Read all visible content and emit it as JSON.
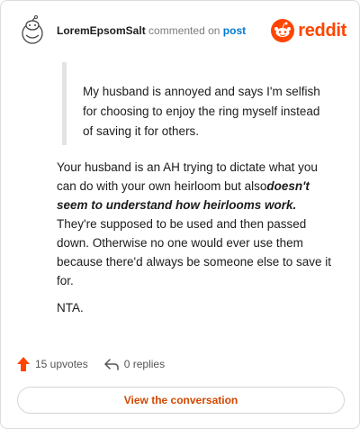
{
  "header": {
    "username": "LoremEpsomSalt",
    "commented_text": "commented on",
    "post_link": "post",
    "brand_word": "reddit",
    "avatar_icon": "snoo-avatar-icon",
    "brand_icon": "reddit-logo-icon"
  },
  "quote": {
    "text": "My husband is annoyed and says I'm selfish for choosing to enjoy the ring myself instead of saving it for others."
  },
  "comment": {
    "part1": "Your husband is an AH trying to dictate what you can do with your own heirloom but also",
    "emphasis": "doesn't seem to understand how heirlooms work.",
    "part2": " They're supposed to be used and then passed down. Otherwise no one would ever use them because there'd always be someone else to save it for.",
    "nta": "NTA."
  },
  "stats": {
    "upvotes": "15 upvotes",
    "replies": "0 replies",
    "upvote_icon": "upvote-arrow-icon",
    "reply_icon": "reply-arrow-icon"
  },
  "cta": {
    "label": "View the conversation"
  },
  "colors": {
    "accent": "#ff4500",
    "link": "#0079d3",
    "cta_text": "#d14800"
  }
}
